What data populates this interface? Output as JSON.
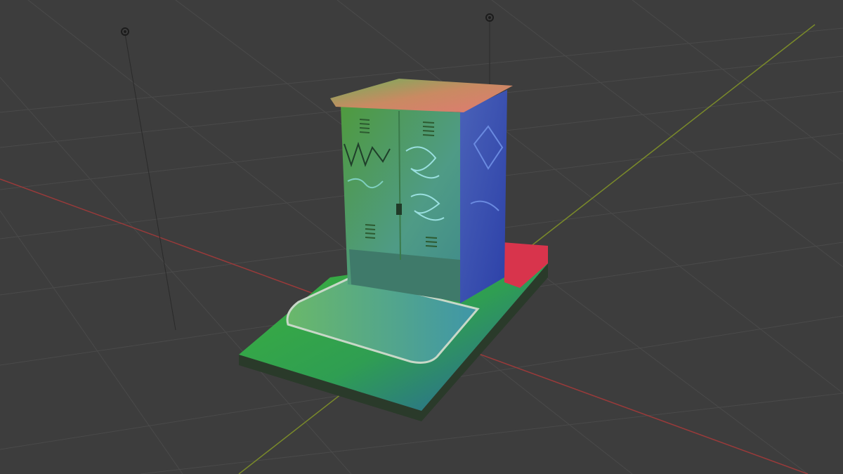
{
  "viewport": {
    "background": "#3d3d3d",
    "grid_color": "#4a4a4a",
    "x_axis_color": "#9a3a3a",
    "y_axis_color": "#7a8a2a"
  },
  "scene_objects": [
    {
      "type": "light",
      "icon": "light-point-icon"
    },
    {
      "type": "light",
      "icon": "light-point-icon"
    },
    {
      "type": "mesh",
      "description_visible": false,
      "colors": {
        "top": "#d8806a",
        "front": "#55a050",
        "side": "#3a55b8",
        "base_grass": "#3fae33",
        "base_red": "#d8344c"
      }
    }
  ]
}
